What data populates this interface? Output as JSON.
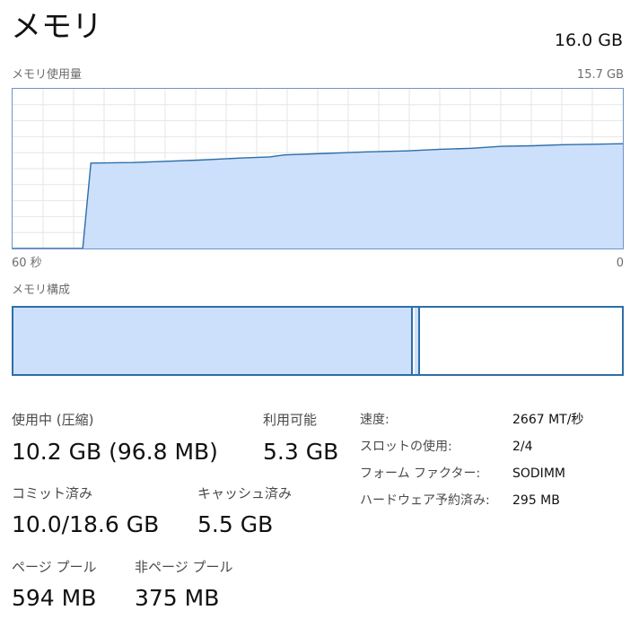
{
  "header": {
    "title": "メモリ",
    "total": "16.0 GB"
  },
  "usage_graph": {
    "label": "メモリ使用量",
    "max_label": "15.7 GB",
    "x_left_label": "60 秒",
    "x_right_label": "0",
    "fill_color": "#cce0fb",
    "line_color": "#2e6ea8"
  },
  "chart_data": {
    "type": "area",
    "xlabel": "",
    "ylabel": "",
    "xlim": [
      60,
      0
    ],
    "ylim": [
      0,
      15.7
    ],
    "x": [
      60,
      53.1,
      52.3,
      48.2,
      45.5,
      41.5,
      37.4,
      34.7,
      33.3,
      29.2,
      25.2,
      21.2,
      18.0,
      14.9,
      11.9,
      8.9,
      5.9,
      3.0,
      0
    ],
    "series": [
      {
        "values": [
          0,
          0,
          8.4,
          8.45,
          8.55,
          8.7,
          8.9,
          9.0,
          9.2,
          9.35,
          9.5,
          9.6,
          9.75,
          9.85,
          10.05,
          10.1,
          10.2,
          10.25,
          10.3
        ]
      }
    ],
    "grid": true
  },
  "composition": {
    "label": "メモリ構成",
    "used_fraction": 0.653,
    "modified_fraction": 0.009
  },
  "stats": {
    "in_use": {
      "label": "使用中 (圧縮)",
      "value": "10.2 GB (96.8 MB)"
    },
    "available": {
      "label": "利用可能",
      "value": "5.3 GB"
    },
    "committed": {
      "label": "コミット済み",
      "value": "10.0/18.6 GB"
    },
    "cached": {
      "label": "キャッシュ済み",
      "value": "5.5 GB"
    },
    "paged_pool": {
      "label": "ページ プール",
      "value": "594 MB"
    },
    "nonpaged_pool": {
      "label": "非ページ プール",
      "value": "375 MB"
    }
  },
  "properties": [
    {
      "key": "速度:",
      "value": "2667 MT/秒"
    },
    {
      "key": "スロットの使用:",
      "value": "2/4"
    },
    {
      "key": "フォーム ファクター:",
      "value": "SODIMM"
    },
    {
      "key": "ハードウェア予約済み:",
      "value": "295 MB"
    }
  ]
}
